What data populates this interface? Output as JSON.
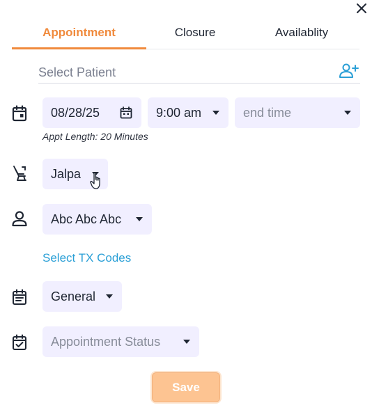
{
  "tabs": [
    {
      "label": "Appointment"
    },
    {
      "label": "Closure"
    },
    {
      "label": "Availablity"
    }
  ],
  "patient": {
    "placeholder": "Select Patient"
  },
  "date": {
    "value": "08/28/25"
  },
  "start_time": {
    "value": "9:00 am"
  },
  "end_time": {
    "placeholder": "end time"
  },
  "appt_length": "Appt Length: 20 Minutes",
  "chair": {
    "value": "Jalpa"
  },
  "provider": {
    "value": "Abc Abc Abc"
  },
  "tx_codes": {
    "label": "Select TX Codes"
  },
  "appt_type": {
    "value": "General"
  },
  "appt_status": {
    "placeholder": "Appointment Status"
  },
  "save_label": "Save",
  "colors": {
    "accent": "#f08a3c",
    "link": "#2a9fd6",
    "pill_bg": "#f1efff",
    "save_bg": "#fdc492"
  }
}
